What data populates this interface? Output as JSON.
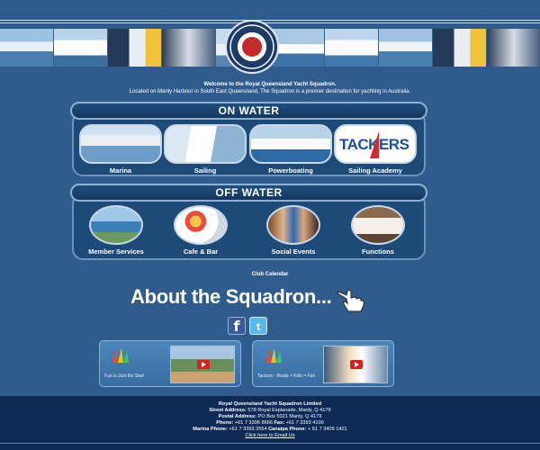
{
  "welcome": {
    "title": "Welcome to the Royal Queensland Yacht Squadron.",
    "subtitle": "Located on Manly Harbour in South East Queensland, The Squadron is a premier destination for yachting in Australia."
  },
  "on_water": {
    "heading": "ON WATER",
    "tiles": [
      {
        "label": "Marina"
      },
      {
        "label": "Sailing"
      },
      {
        "label": "Powerboating"
      },
      {
        "label": "Sailing Academy",
        "image_text": "TACKERS"
      }
    ]
  },
  "off_water": {
    "heading": "OFF WATER",
    "tiles": [
      {
        "label": "Member Services"
      },
      {
        "label": "Cafe & Bar"
      },
      {
        "label": "Social Events"
      },
      {
        "label": "Functions"
      }
    ]
  },
  "club_calendar": "Club Calendar",
  "about_link": "About the Squadron...",
  "videos": [
    {
      "caption": "Fun is Just the Start"
    },
    {
      "caption": "Tackers - Boats + Kids = Fun"
    }
  ],
  "footer": {
    "org": "Royal Queensland Yacht Squadron Limited",
    "street_label": "Street Address:",
    "street": "578 Royal Esplanade, Manly, Q 4179",
    "postal_label": "Postal Address:",
    "postal": "PO Box 5021 Manly, Q 4179",
    "phone_label": "Phone:",
    "phone": "+61 7 3396 8666",
    "fax_label": "Fax:",
    "fax": "+61 7 3393 4100",
    "marina_label": "Marina Phone:",
    "marina": "+61 7 3393 3554",
    "canaipa_label": "Canaipa Phone:",
    "canaipa": "+ 61 7 3409 1421",
    "email_link": "Click here to Email Us"
  },
  "colors": {
    "page_bg": "#2f5c8c",
    "panel_bg": "#1e4a78",
    "footer_bg": "#0c2a55"
  },
  "icons": [
    "crest-logo",
    "hand-pointer-icon",
    "facebook-icon",
    "twitter-icon",
    "play-icon"
  ]
}
